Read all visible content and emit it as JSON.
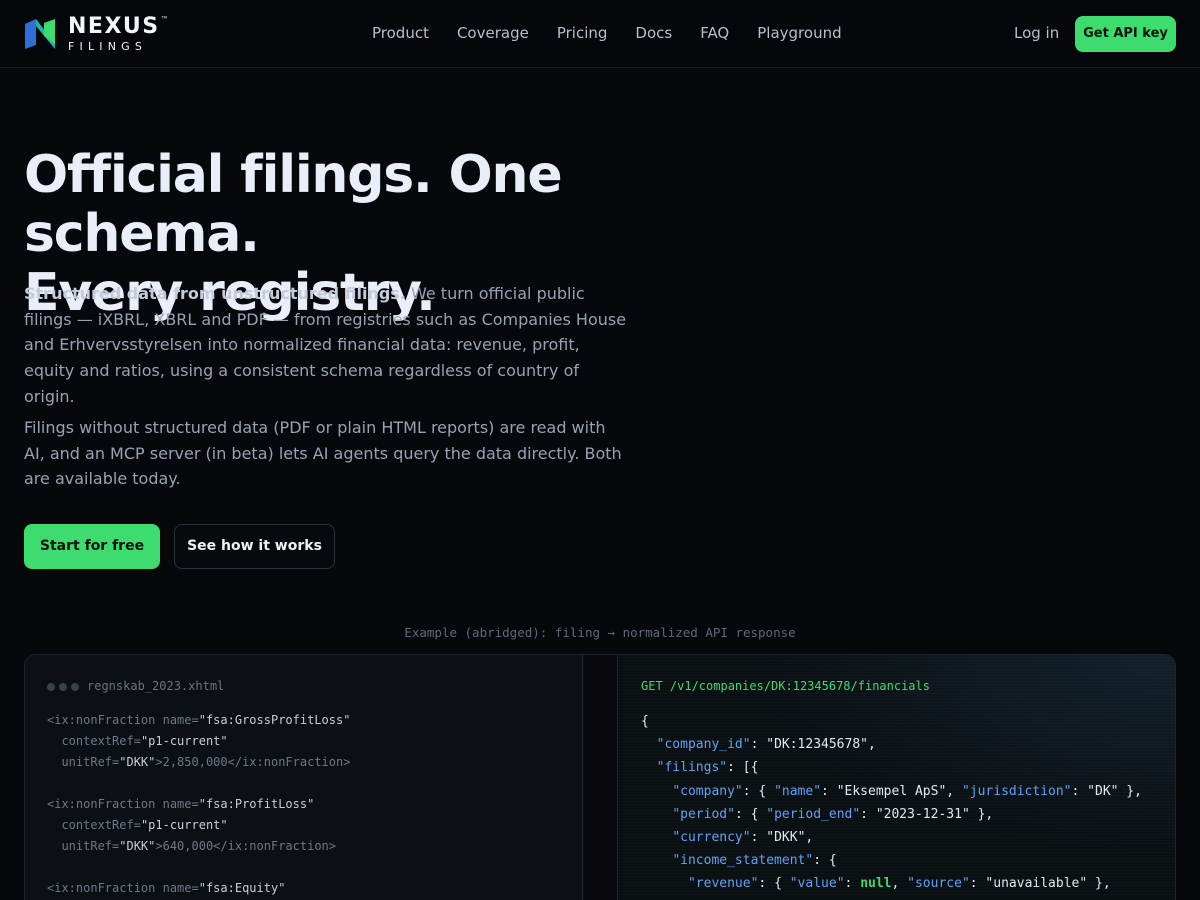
{
  "brand": {
    "word": "NEXUS",
    "sub": "FILINGS",
    "tm": "™",
    "colors": {
      "accent": "#3ddc6e",
      "mark_blue": "#2e6fd8",
      "mark_teal": "#1fb6a8"
    }
  },
  "nav": {
    "links": [
      "Product",
      "Coverage",
      "Pricing",
      "Docs",
      "FAQ",
      "Playground"
    ],
    "login": "Log in",
    "cta": "Get API key"
  },
  "hero": {
    "title_line1": "Official filings. One schema.",
    "title_line2": "Every registry.",
    "lead_bold": "Structured data from unstructured filings.",
    "lead_rest": " We turn official public filings — iXBRL, XBRL and PDF — from registries such as Companies House and Erhvervsstyrelsen into normalized financial data: revenue, profit, equity and ratios, using a consistent schema regardless of country of origin.",
    "lead2": "Filings without structured data (PDF or plain HTML reports) are read with AI, and an MCP server (in beta) lets AI agents query the data directly. Both are available today.",
    "primary_button": "Start for free",
    "secondary_button": "See how it works"
  },
  "example": {
    "caption": "Example (abridged): filing → normalized API response",
    "file_name": "regnskab_2023.xhtml",
    "xml_blocks": [
      {
        "tag_open": "<ix:nonFraction name=",
        "name": "\"fsa:GrossProfitLoss\"",
        "ctx_pre": "contextRef=",
        "ctx": "\"p1-current\"",
        "unit_pre": "unitRef=",
        "unit": "\"DKK\"",
        "value_line": ">2,850,000</ix:nonFraction>"
      },
      {
        "tag_open": "<ix:nonFraction name=",
        "name": "\"fsa:ProfitLoss\"",
        "ctx_pre": "contextRef=",
        "ctx": "\"p1-current\"",
        "unit_pre": "unitRef=",
        "unit": "\"DKK\"",
        "value_line": ">640,000</ix:nonFraction>"
      },
      {
        "tag_open": "<ix:nonFraction name=",
        "name": "\"fsa:Equity\""
      }
    ],
    "endpoint": "GET /v1/companies/DK:12345678/financials",
    "json": {
      "company_id": "DK:12345678",
      "company_name": "Eksempel ApS",
      "jurisdiction": "DK",
      "period_end": "2023-12-31",
      "currency": "DKK",
      "revenue_value": "null",
      "revenue_source": "unavailable"
    }
  }
}
